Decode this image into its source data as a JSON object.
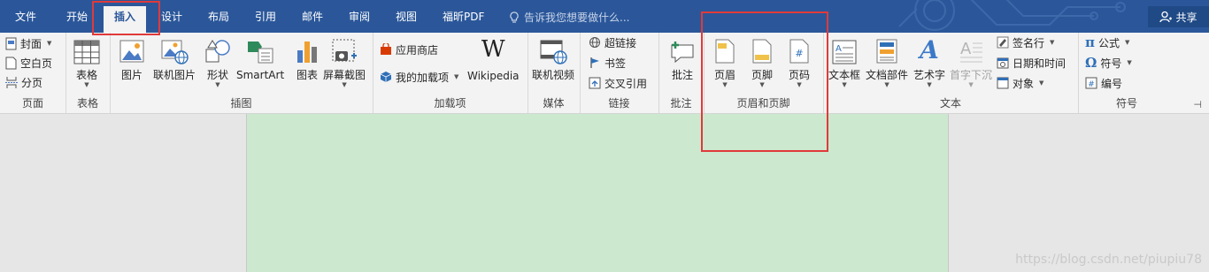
{
  "tabs": [
    "文件",
    "开始",
    "插入",
    "设计",
    "布局",
    "引用",
    "邮件",
    "审阅",
    "视图",
    "福昕PDF"
  ],
  "tell_me": "告诉我您想要做什么...",
  "share": "共享",
  "groups": {
    "pages": {
      "label": "页面",
      "cover": "封面",
      "blank": "空白页",
      "break": "分页"
    },
    "tables": {
      "label": "表格",
      "table": "表格"
    },
    "illustrations": {
      "label": "插图",
      "picture": "图片",
      "online_picture": "联机图片",
      "shapes": "形状",
      "smartart": "SmartArt",
      "chart": "图表",
      "screenshot": "屏幕截图"
    },
    "addins": {
      "label": "加载项",
      "store": "应用商店",
      "my_addins": "我的加载项",
      "wikipedia": "Wikipedia"
    },
    "media": {
      "label": "媒体",
      "online_video": "联机视频"
    },
    "links": {
      "label": "链接",
      "hyperlink": "超链接",
      "bookmark": "书签",
      "cross_ref": "交叉引用"
    },
    "comments": {
      "label": "批注",
      "comment": "批注"
    },
    "header_footer": {
      "label": "页眉和页脚",
      "header": "页眉",
      "footer": "页脚",
      "page_number": "页码"
    },
    "text": {
      "label": "文本",
      "textbox": "文本框",
      "quickparts": "文档部件",
      "wordart": "艺术字",
      "dropcap": "首字下沉",
      "signature": "签名行",
      "datetime": "日期和时间",
      "object": "对象"
    },
    "symbols": {
      "label": "符号",
      "equation": "公式",
      "symbol": "符号",
      "number": "编号"
    }
  },
  "watermark": "https://blog.csdn.net/piupiu78",
  "colors": {
    "brand": "#2b579a",
    "page": "#cce8cf",
    "highlight": "#e03a3a"
  }
}
